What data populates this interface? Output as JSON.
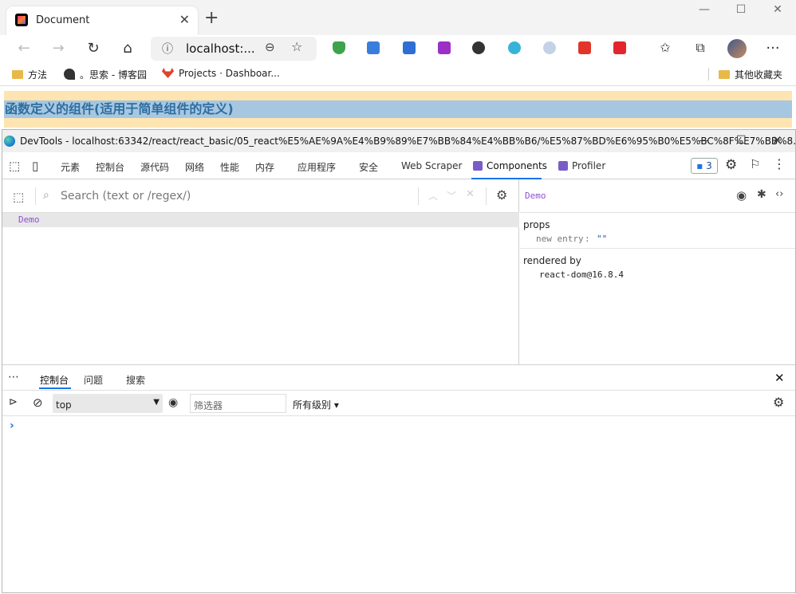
{
  "browser": {
    "tab_title": "Document",
    "url": "localhost:...",
    "bookmarks": [
      "方法",
      "。思索 - 博客园",
      "Projects · Dashboar...",
      "其他收藏夹"
    ]
  },
  "page": {
    "heading": "函数定义的组件(适用于简单组件的定义)"
  },
  "devtools": {
    "window_title": "DevTools - localhost:63342/react/react_basic/05_react%E5%AE%9A%E4%B9%89%E7%BB%84%E4%BB%B6/%E5%87%BD%E6%95%B0%E5%BC%8F%E7%BB%8...",
    "tabs": [
      "元素",
      "控制台",
      "源代码",
      "网络",
      "性能",
      "内存",
      "应用程序",
      "安全",
      "Web Scraper",
      "Components",
      "Profiler"
    ],
    "active_tab": "Components",
    "issues_count": "3",
    "components": {
      "search_placeholder": "Search (text or /regex/)",
      "tree": [
        "Demo"
      ],
      "selected": "Demo",
      "props_label": "props",
      "prop_key": "new entry",
      "prop_value": "\"\"",
      "rendered_by_label": "rendered by",
      "renderer": "react-dom@16.8.4"
    },
    "drawer": {
      "tabs": [
        "控制台",
        "问题",
        "搜索"
      ],
      "context": "top",
      "filter_placeholder": "筛选器",
      "levels": "所有级别 ▾",
      "prompt": "›"
    }
  }
}
